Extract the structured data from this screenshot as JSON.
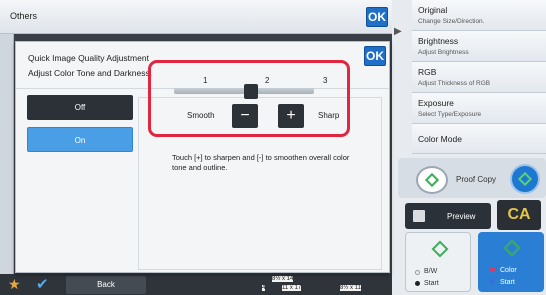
{
  "base": {
    "title": "Others",
    "ok_label": "OK"
  },
  "right_panel": {
    "items": [
      {
        "title": "Original",
        "sub": "Change Size/Direction."
      },
      {
        "title": "Brightness",
        "sub": "Adjust Brightness"
      },
      {
        "title": "RGB",
        "sub": "Adjust Thickness of RGB"
      },
      {
        "title": "Exposure",
        "sub": "Select Type/Exposure"
      },
      {
        "title": "Color Mode",
        "sub": ""
      }
    ],
    "proof_copy": "Proof Copy",
    "preview": "Preview",
    "ca": "CA",
    "bw_start": {
      "line1": "B/W",
      "line2": "Start"
    },
    "color_start": {
      "line1": "Color",
      "line2": "Start"
    }
  },
  "bottom_bar": {
    "back_label": "Back",
    "tray1": "8½ x 14",
    "tray_num": "4",
    "tray2": "11 x 17",
    "tray3": "8½ x 11"
  },
  "dialog": {
    "title": "Quick Image Quality Adjustment",
    "subtitle": "Adjust Color Tone and Darkness.",
    "ok_label": "OK",
    "options": {
      "off": "Off",
      "on": "On",
      "selected": "On"
    },
    "slider": {
      "ticks": [
        "1",
        "2",
        "3"
      ],
      "value": 2,
      "min_label": "Smooth",
      "max_label": "Sharp",
      "minus": "−",
      "plus": "+"
    },
    "help_text": "Touch [+] to sharpen and [-] to smoothen overall color tone and outline."
  },
  "colors": {
    "accent": "#1f6fc6",
    "selected": "#4a9ee6",
    "highlight": "#e1263f"
  }
}
